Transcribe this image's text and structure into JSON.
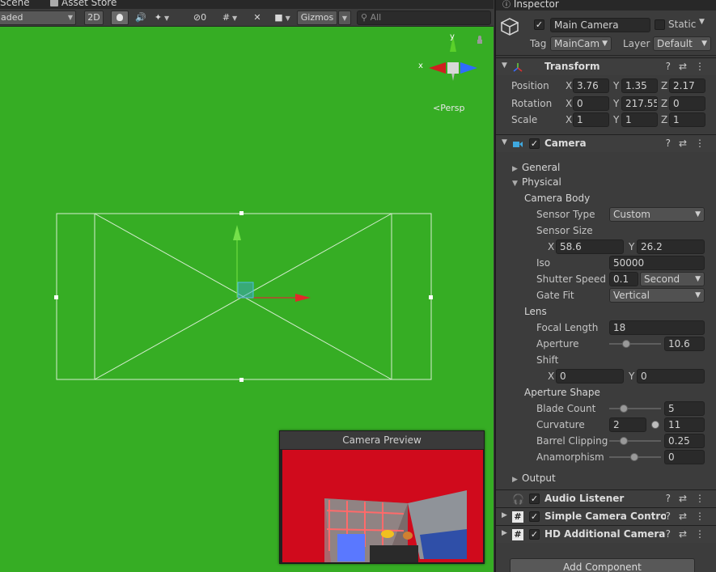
{
  "scene_tabs": {
    "scene": "Scene",
    "asset_store": "Asset Store"
  },
  "scene_toolbar": {
    "shading_mode": "aded",
    "toggle_2d": "2D",
    "hidden_count": "0",
    "gizmos": "Gizmos",
    "search_placeholder": "All"
  },
  "scene_gizmo": {
    "x": "x",
    "y": "y",
    "persp": "Persp"
  },
  "camera_preview": {
    "title": "Camera Preview"
  },
  "inspector": {
    "tab": "Inspector",
    "object": {
      "name": "Main Camera",
      "static_label": "Static",
      "tag_label": "Tag",
      "tag_value": "MainCam",
      "layer_label": "Layer",
      "layer_value": "Default"
    },
    "transform": {
      "title": "Transform",
      "position_label": "Position",
      "rotation_label": "Rotation",
      "scale_label": "Scale",
      "position": {
        "x": "3.76",
        "y": "1.35",
        "z": "2.17"
      },
      "rotation": {
        "x": "0",
        "y": "217.55",
        "z": "0"
      },
      "scale": {
        "x": "1",
        "y": "1",
        "z": "1"
      },
      "axis_x": "X",
      "axis_y": "Y",
      "axis_z": "Z"
    },
    "camera": {
      "title": "Camera",
      "general": "General",
      "physical": "Physical",
      "camera_body": "Camera Body",
      "sensor_type_label": "Sensor Type",
      "sensor_type_value": "Custom",
      "sensor_size_label": "Sensor Size",
      "sensor_size_x": "58.6",
      "sensor_size_y": "26.2",
      "iso_label": "Iso",
      "iso_value": "50000",
      "shutter_speed_label": "Shutter Speed",
      "shutter_speed_value": "0.1",
      "shutter_unit": "Second",
      "gate_fit_label": "Gate Fit",
      "gate_fit_value": "Vertical",
      "lens": "Lens",
      "focal_length_label": "Focal Length",
      "focal_length_value": "18",
      "aperture_label": "Aperture",
      "aperture_value": "10.6",
      "shift_label": "Shift",
      "shift_x": "0",
      "shift_y": "0",
      "aperture_shape": "Aperture Shape",
      "blade_count_label": "Blade Count",
      "blade_count_value": "5",
      "curvature_label": "Curvature",
      "curvature_min": "2",
      "curvature_max": "11",
      "barrel_clipping_label": "Barrel Clipping",
      "barrel_clipping_value": "0.25",
      "anamorphism_label": "Anamorphism",
      "anamorphism_value": "0",
      "output": "Output"
    },
    "components": {
      "audio_listener": "Audio Listener",
      "simple_camera_controller": "Simple Camera Controll",
      "hd_additional_camera": "HD Additional Camera D"
    },
    "add_component": "Add Component"
  },
  "colors": {
    "scene_background": "#36ad24",
    "panel": "#3c3c3c",
    "field": "#2a2a2a",
    "gizmo_x": "#d02020",
    "gizmo_y": "#5ad02a",
    "gizmo_z": "#2f6cff",
    "preview_background": "#d00a1c"
  }
}
